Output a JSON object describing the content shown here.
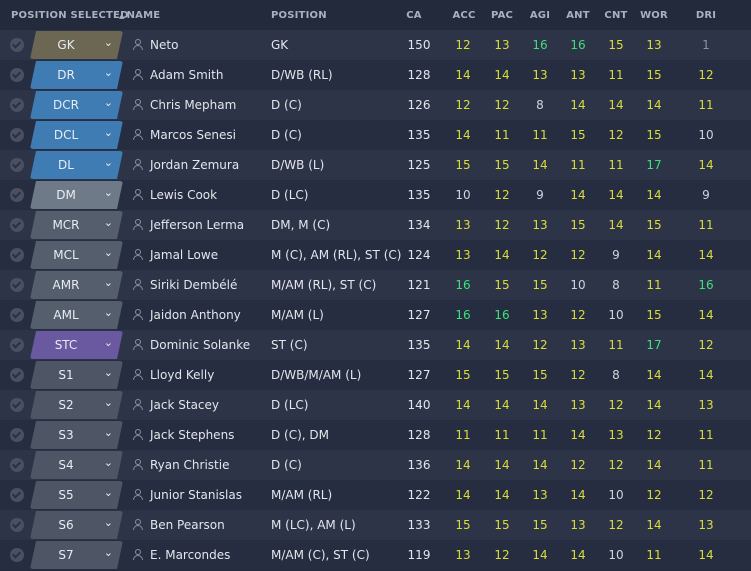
{
  "colors": {
    "GK": "#6b6752",
    "DR": "#3f7cb4",
    "DCR": "#3f7cb4",
    "DCL": "#3f7cb4",
    "DL": "#3f7cb4",
    "DM": "#6e7a88",
    "MCR": "#555e6c",
    "MCL": "#555e6c",
    "AMR": "#555e6c",
    "AML": "#555e6c",
    "STC": "#6a58a0",
    "SUB": "#4e5565"
  },
  "header": {
    "position_selected": "POSITION SELECTED",
    "name": "NAME",
    "position": "POSITION",
    "ca": "CA",
    "acc": "ACC",
    "pac": "PAC",
    "agi": "AGI",
    "ant": "ANT",
    "cnt": "CNT",
    "wor": "WOR",
    "dri": "DRI"
  },
  "rows": [
    {
      "slot": "GK",
      "ctype": "GK",
      "name": "Neto",
      "position": "GK",
      "ca": "150",
      "acc": "12",
      "pac": "13",
      "agi": "16",
      "ant": "16",
      "cnt": "15",
      "wor": "13",
      "dri": "1"
    },
    {
      "slot": "DR",
      "ctype": "DR",
      "name": "Adam Smith",
      "position": "D/WB (RL)",
      "ca": "128",
      "acc": "14",
      "pac": "14",
      "agi": "13",
      "ant": "13",
      "cnt": "11",
      "wor": "15",
      "dri": "12"
    },
    {
      "slot": "DCR",
      "ctype": "DCR",
      "name": "Chris Mepham",
      "position": "D (C)",
      "ca": "126",
      "acc": "12",
      "pac": "12",
      "agi": "8",
      "ant": "14",
      "cnt": "14",
      "wor": "14",
      "dri": "11"
    },
    {
      "slot": "DCL",
      "ctype": "DCL",
      "name": "Marcos Senesi",
      "position": "D (C)",
      "ca": "135",
      "acc": "14",
      "pac": "11",
      "agi": "11",
      "ant": "15",
      "cnt": "12",
      "wor": "15",
      "dri": "10"
    },
    {
      "slot": "DL",
      "ctype": "DL",
      "name": "Jordan Zemura",
      "position": "D/WB (L)",
      "ca": "125",
      "acc": "15",
      "pac": "15",
      "agi": "14",
      "ant": "11",
      "cnt": "11",
      "wor": "17",
      "dri": "14"
    },
    {
      "slot": "DM",
      "ctype": "DM",
      "name": "Lewis Cook",
      "position": "D (LC)",
      "ca": "135",
      "acc": "10",
      "pac": "12",
      "agi": "9",
      "ant": "14",
      "cnt": "14",
      "wor": "14",
      "dri": "9"
    },
    {
      "slot": "MCR",
      "ctype": "MCR",
      "name": "Jefferson Lerma",
      "position": "DM, M (C)",
      "ca": "134",
      "acc": "13",
      "pac": "12",
      "agi": "13",
      "ant": "15",
      "cnt": "14",
      "wor": "15",
      "dri": "11"
    },
    {
      "slot": "MCL",
      "ctype": "MCL",
      "name": "Jamal Lowe",
      "position": "M (C), AM (RL), ST (C)",
      "ca": "124",
      "acc": "13",
      "pac": "14",
      "agi": "12",
      "ant": "12",
      "cnt": "9",
      "wor": "14",
      "dri": "14"
    },
    {
      "slot": "AMR",
      "ctype": "AMR",
      "name": "Siriki Dembélé",
      "position": "M/AM (RL), ST (C)",
      "ca": "121",
      "acc": "16",
      "pac": "15",
      "agi": "15",
      "ant": "10",
      "cnt": "8",
      "wor": "11",
      "dri": "16"
    },
    {
      "slot": "AML",
      "ctype": "AML",
      "name": "Jaidon Anthony",
      "position": "M/AM (L)",
      "ca": "127",
      "acc": "16",
      "pac": "16",
      "agi": "13",
      "ant": "12",
      "cnt": "10",
      "wor": "15",
      "dri": "14"
    },
    {
      "slot": "STC",
      "ctype": "STC",
      "name": "Dominic Solanke",
      "position": "ST (C)",
      "ca": "135",
      "acc": "14",
      "pac": "14",
      "agi": "12",
      "ant": "13",
      "cnt": "11",
      "wor": "17",
      "dri": "12"
    },
    {
      "slot": "S1",
      "ctype": "SUB",
      "name": "Lloyd Kelly",
      "position": "D/WB/M/AM (L)",
      "ca": "127",
      "acc": "15",
      "pac": "15",
      "agi": "15",
      "ant": "12",
      "cnt": "8",
      "wor": "14",
      "dri": "14"
    },
    {
      "slot": "S2",
      "ctype": "SUB",
      "name": "Jack Stacey",
      "position": "D (LC)",
      "ca": "140",
      "acc": "14",
      "pac": "14",
      "agi": "14",
      "ant": "13",
      "cnt": "12",
      "wor": "14",
      "dri": "13"
    },
    {
      "slot": "S3",
      "ctype": "SUB",
      "name": "Jack Stephens",
      "position": "D (C), DM",
      "ca": "128",
      "acc": "11",
      "pac": "11",
      "agi": "11",
      "ant": "14",
      "cnt": "13",
      "wor": "12",
      "dri": "11"
    },
    {
      "slot": "S4",
      "ctype": "SUB",
      "name": "Ryan Christie",
      "position": "D (C)",
      "ca": "136",
      "acc": "14",
      "pac": "14",
      "agi": "14",
      "ant": "12",
      "cnt": "12",
      "wor": "14",
      "dri": "11"
    },
    {
      "slot": "S5",
      "ctype": "SUB",
      "name": "Junior Stanislas",
      "position": "M/AM (RL)",
      "ca": "122",
      "acc": "14",
      "pac": "14",
      "agi": "13",
      "ant": "14",
      "cnt": "10",
      "wor": "12",
      "dri": "12"
    },
    {
      "slot": "S6",
      "ctype": "SUB",
      "name": "Ben Pearson",
      "position": "M (LC), AM (L)",
      "ca": "133",
      "acc": "15",
      "pac": "15",
      "agi": "15",
      "ant": "13",
      "cnt": "12",
      "wor": "14",
      "dri": "13"
    },
    {
      "slot": "S7",
      "ctype": "SUB",
      "name": "E. Marcondes",
      "position": "M/AM (C), ST (C)",
      "ca": "119",
      "acc": "13",
      "pac": "12",
      "agi": "14",
      "ant": "14",
      "cnt": "10",
      "wor": "11",
      "dri": "14"
    }
  ]
}
